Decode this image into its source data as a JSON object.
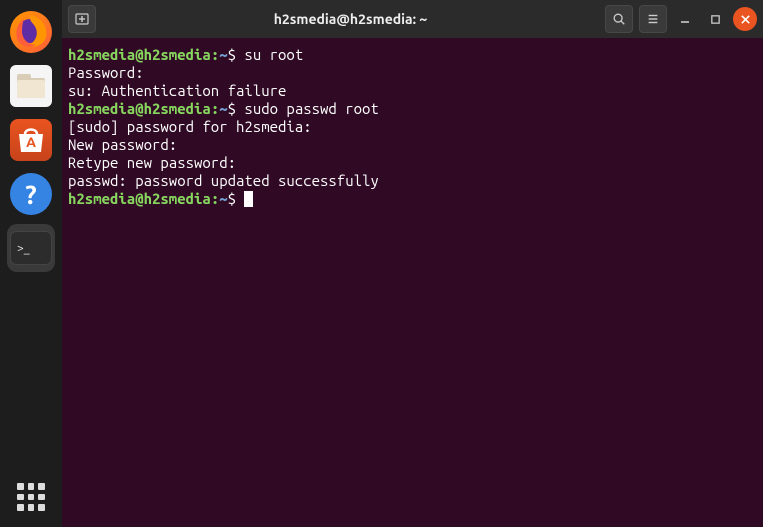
{
  "titlebar": {
    "title": "h2smedia@h2smedia: ~"
  },
  "dock": {
    "firefox": "firefox",
    "files": "files",
    "software": "ubuntu-software",
    "help": "help",
    "terminal": "terminal",
    "apps": "show-applications"
  },
  "terminal": {
    "prompt_user": "h2smedia@h2smedia",
    "prompt_sep": ":",
    "prompt_path": "~",
    "prompt_symbol": "$",
    "lines": {
      "cmd1": " su root",
      "out1": "Password:",
      "out2": "su: Authentication failure",
      "cmd2": " sudo passwd root",
      "out3": "[sudo] password for h2smedia:",
      "out4": "New password:",
      "out5": "Retype new password:",
      "out6": "passwd: password updated successfully",
      "cmd3": " "
    }
  }
}
